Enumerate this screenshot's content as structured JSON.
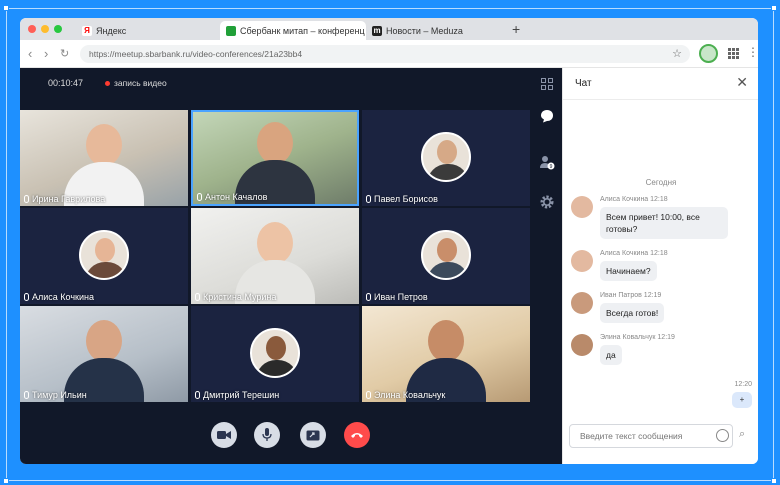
{
  "tabs": [
    {
      "label": "Яндекс",
      "icon": "yandex-icon",
      "color": "#ff0000",
      "glyph": "Я"
    },
    {
      "label": "Сбербанк митап – конференц",
      "icon": "sber-icon",
      "color": "#21a038",
      "glyph": ""
    },
    {
      "label": "Новости – Meduza",
      "icon": "meduza-icon",
      "color": "#222222",
      "glyph": "m"
    }
  ],
  "address": {
    "url": "https://meetup.sbarbank.ru/video-conferences/21a23bb4"
  },
  "call": {
    "timer": "00:10:47",
    "recording": "запись видео",
    "participants": [
      {
        "name": "Ирина Гаврилова"
      },
      {
        "name": "Антон Качалов"
      },
      {
        "name": "Павел Борисов"
      },
      {
        "name": "Алиса Кочкина"
      },
      {
        "name": "Кристина Мурина"
      },
      {
        "name": "Иван Петров"
      },
      {
        "name": "Тимур Ильин"
      },
      {
        "name": "Дмитрий Терешин"
      },
      {
        "name": "Элина Ковальчук"
      }
    ]
  },
  "chat": {
    "title": "Чат",
    "date": "Сегодня",
    "messages": [
      {
        "meta": "Алиса Кочкина 12:18",
        "text": "Всем привет! 10:00, все готовы?"
      },
      {
        "meta": "Алиса Кочкина 12:18",
        "text": "Начинаем?"
      },
      {
        "meta": "Иван Патров 12:19",
        "text": "Всегда готов!"
      },
      {
        "meta": "Элина Ковальчук 12:19",
        "text": "да"
      }
    ],
    "own": {
      "time": "12:20",
      "text": "+"
    },
    "input_placeholder": "Введите текст сообщения"
  },
  "colors": {
    "accent": "#1e90ff",
    "end_call": "#ff4b4b",
    "call_bg": "#111829",
    "speaking": "#4aa3ff"
  }
}
